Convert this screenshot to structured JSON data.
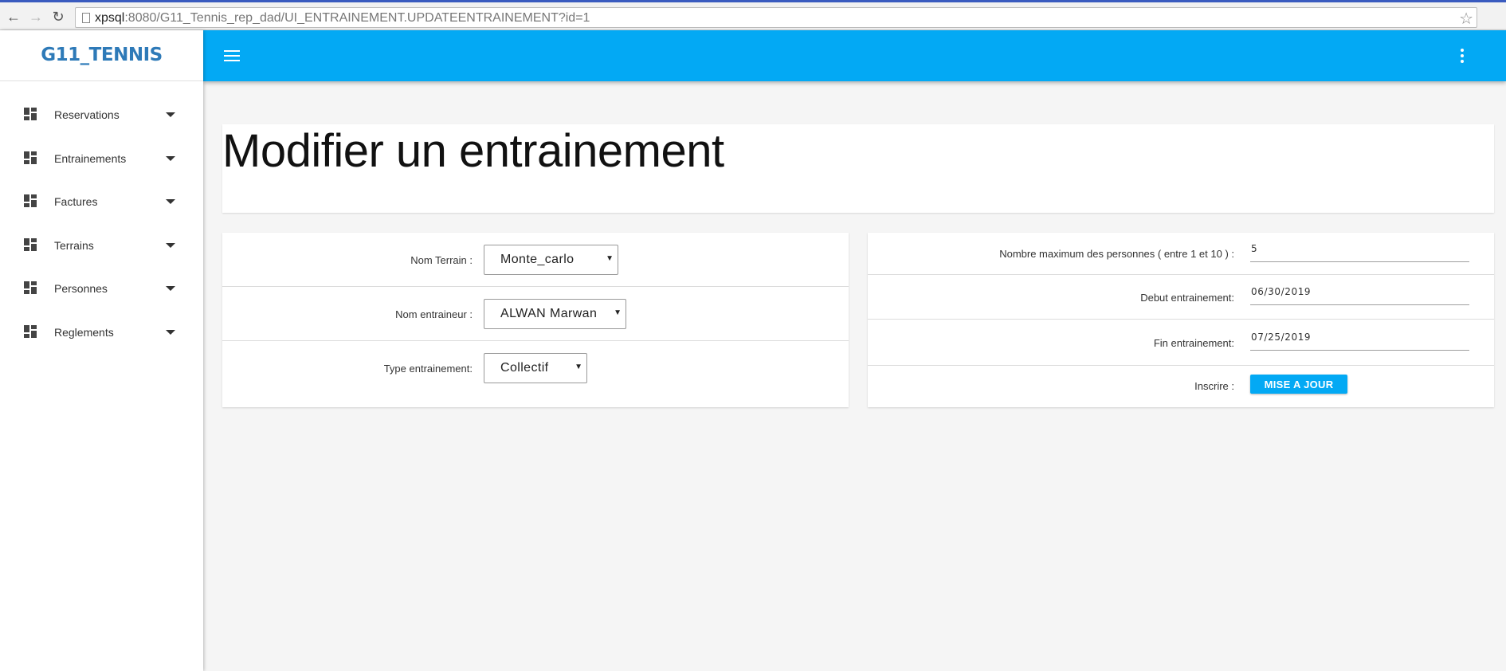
{
  "browser": {
    "url_host": "xpsql",
    "url_rest": ":8080/G11_Tennis_rep_dad/UI_ENTRAINEMENT.UPDATEENTRAINEMENT?id=1"
  },
  "sidebar": {
    "brand": "G11_TENNIS",
    "items": [
      {
        "label": "Reservations"
      },
      {
        "label": "Entrainements"
      },
      {
        "label": "Factures"
      },
      {
        "label": "Terrains"
      },
      {
        "label": "Personnes"
      },
      {
        "label": "Reglements"
      }
    ]
  },
  "page": {
    "title": "Modifier un entrainement"
  },
  "form_left": {
    "terrain_label": "Nom Terrain :",
    "terrain_value": "Monte_carlo",
    "entraineur_label": "Nom entraineur :",
    "entraineur_value": "ALWAN Marwan",
    "type_label": "Type entrainement:",
    "type_value": "Collectif"
  },
  "form_right": {
    "max_label": "Nombre maximum des personnes ( entre 1 et 10 ) :",
    "max_value": "5",
    "debut_label": "Debut entrainement:",
    "debut_value": "06/30/2019",
    "fin_label": "Fin entrainement:",
    "fin_value": "07/25/2019",
    "inscrire_label": "Inscrire :",
    "submit_label": "MISE A JOUR"
  },
  "colors": {
    "accent": "#03a9f4",
    "brand": "#2e7ab8"
  }
}
